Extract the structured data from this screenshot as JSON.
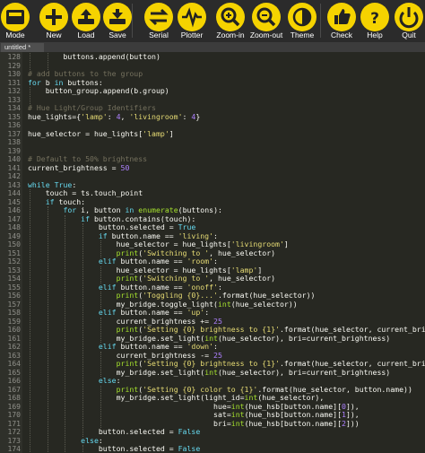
{
  "toolbar": {
    "buttons": [
      {
        "id": "mode",
        "label": "Mode",
        "icon": "mode-icon"
      },
      {
        "id": "new",
        "label": "New",
        "icon": "plus-icon"
      },
      {
        "id": "load",
        "label": "Load",
        "icon": "load-icon"
      },
      {
        "id": "save",
        "label": "Save",
        "icon": "save-icon"
      },
      {
        "id": "serial",
        "label": "Serial",
        "icon": "serial-icon"
      },
      {
        "id": "plotter",
        "label": "Plotter",
        "icon": "plotter-icon"
      },
      {
        "id": "zoom-in",
        "label": "Zoom-in",
        "icon": "zoom-in-icon"
      },
      {
        "id": "zoom-out",
        "label": "Zoom-out",
        "icon": "zoom-out-icon"
      },
      {
        "id": "theme",
        "label": "Theme",
        "icon": "theme-icon"
      },
      {
        "id": "check",
        "label": "Check",
        "icon": "check-icon"
      },
      {
        "id": "help",
        "label": "Help",
        "icon": "help-icon"
      },
      {
        "id": "quit",
        "label": "Quit",
        "icon": "quit-icon"
      }
    ]
  },
  "tab": {
    "title": "untitled *"
  },
  "colors": {
    "accent": "#f5d300",
    "background": "#272822",
    "toolbar": "#2b2b2b",
    "keyword": "#66d9ef",
    "string": "#e6db74",
    "comment": "#75715e",
    "number": "#ae81ff",
    "builtin": "#a6e22e"
  },
  "editor": {
    "lines": [
      {
        "n": "128",
        "indent": 2,
        "tokens": [
          [
            "",
            "buttons.append(button)"
          ]
        ]
      },
      {
        "n": "129",
        "indent": 0,
        "tokens": []
      },
      {
        "n": "130",
        "indent": 0,
        "tokens": [
          [
            "c",
            "# add buttons to the group"
          ]
        ]
      },
      {
        "n": "131",
        "indent": 0,
        "tokens": [
          [
            "k",
            "for"
          ],
          [
            "",
            " b "
          ],
          [
            "k",
            "in"
          ],
          [
            "",
            " buttons:"
          ]
        ]
      },
      {
        "n": "132",
        "indent": 1,
        "tokens": [
          [
            "",
            "button_group.append(b.group)"
          ]
        ]
      },
      {
        "n": "133",
        "indent": 0,
        "tokens": []
      },
      {
        "n": "134",
        "indent": 0,
        "tokens": [
          [
            "c",
            "# Hue Light/Group Identifiers"
          ]
        ]
      },
      {
        "n": "135",
        "indent": 0,
        "tokens": [
          [
            "",
            "hue_lights={"
          ],
          [
            "s",
            "'lamp'"
          ],
          [
            "",
            ": "
          ],
          [
            "n",
            "4"
          ],
          [
            "",
            ", "
          ],
          [
            "s",
            "'livingroom'"
          ],
          [
            "",
            ": "
          ],
          [
            "n",
            "4"
          ],
          [
            "",
            "}"
          ]
        ]
      },
      {
        "n": "136",
        "indent": 0,
        "tokens": []
      },
      {
        "n": "137",
        "indent": 0,
        "tokens": [
          [
            "",
            "hue_selector = hue_lights["
          ],
          [
            "s",
            "'lamp'"
          ],
          [
            "",
            "]"
          ]
        ]
      },
      {
        "n": "138",
        "indent": 0,
        "tokens": []
      },
      {
        "n": "139",
        "indent": 0,
        "tokens": []
      },
      {
        "n": "140",
        "indent": 0,
        "tokens": [
          [
            "c",
            "# Default to 50% brightness"
          ]
        ]
      },
      {
        "n": "141",
        "indent": 0,
        "tokens": [
          [
            "",
            "current_brightness = "
          ],
          [
            "n",
            "50"
          ]
        ]
      },
      {
        "n": "142",
        "indent": 0,
        "tokens": []
      },
      {
        "n": "143",
        "indent": 0,
        "tokens": [
          [
            "k",
            "while"
          ],
          [
            "",
            " "
          ],
          [
            "k",
            "True"
          ],
          [
            "",
            ":"
          ]
        ]
      },
      {
        "n": "144",
        "indent": 1,
        "tokens": [
          [
            "",
            "touch = ts.touch_point"
          ]
        ]
      },
      {
        "n": "145",
        "indent": 1,
        "tokens": [
          [
            "k",
            "if"
          ],
          [
            "",
            " touch:"
          ]
        ]
      },
      {
        "n": "146",
        "indent": 2,
        "tokens": [
          [
            "k",
            "for"
          ],
          [
            "",
            " i, button "
          ],
          [
            "k",
            "in"
          ],
          [
            "",
            " "
          ],
          [
            "b",
            "enumerate"
          ],
          [
            "",
            "(buttons):"
          ]
        ]
      },
      {
        "n": "147",
        "indent": 3,
        "tokens": [
          [
            "k",
            "if"
          ],
          [
            "",
            " button.contains(touch):"
          ]
        ]
      },
      {
        "n": "148",
        "indent": 4,
        "tokens": [
          [
            "",
            "button.selected = "
          ],
          [
            "k",
            "True"
          ]
        ]
      },
      {
        "n": "149",
        "indent": 4,
        "tokens": [
          [
            "k",
            "if"
          ],
          [
            "",
            " button.name == "
          ],
          [
            "s",
            "'living'"
          ],
          [
            "",
            ":"
          ]
        ]
      },
      {
        "n": "150",
        "indent": 5,
        "tokens": [
          [
            "",
            "hue_selector = hue_lights["
          ],
          [
            "s",
            "'livingroom'"
          ],
          [
            "",
            "]"
          ]
        ]
      },
      {
        "n": "151",
        "indent": 5,
        "tokens": [
          [
            "b",
            "print"
          ],
          [
            "",
            "("
          ],
          [
            "s",
            "'Switching to '"
          ],
          [
            "",
            ", hue_selector)"
          ]
        ]
      },
      {
        "n": "152",
        "indent": 4,
        "tokens": [
          [
            "k",
            "elif"
          ],
          [
            "",
            " button.name == "
          ],
          [
            "s",
            "'room'"
          ],
          [
            "",
            ":"
          ]
        ]
      },
      {
        "n": "153",
        "indent": 5,
        "tokens": [
          [
            "",
            "hue_selector = hue_lights["
          ],
          [
            "s",
            "'lamp'"
          ],
          [
            "",
            "]"
          ]
        ]
      },
      {
        "n": "154",
        "indent": 5,
        "tokens": [
          [
            "b",
            "print"
          ],
          [
            "",
            "("
          ],
          [
            "s",
            "'Switching to '"
          ],
          [
            "",
            ", hue_selector)"
          ]
        ]
      },
      {
        "n": "155",
        "indent": 4,
        "tokens": [
          [
            "k",
            "elif"
          ],
          [
            "",
            " button.name == "
          ],
          [
            "s",
            "'onoff'"
          ],
          [
            "",
            ":"
          ]
        ]
      },
      {
        "n": "156",
        "indent": 5,
        "tokens": [
          [
            "b",
            "print"
          ],
          [
            "",
            "("
          ],
          [
            "s",
            "'Toggling {0}...'"
          ],
          [
            "",
            ".format(hue_selector))"
          ]
        ]
      },
      {
        "n": "157",
        "indent": 5,
        "tokens": [
          [
            "",
            "my_bridge.toggle_light("
          ],
          [
            "b",
            "int"
          ],
          [
            "",
            "(hue_selector))"
          ]
        ]
      },
      {
        "n": "158",
        "indent": 4,
        "tokens": [
          [
            "k",
            "elif"
          ],
          [
            "",
            " button.name == "
          ],
          [
            "s",
            "'up'"
          ],
          [
            "",
            ":"
          ]
        ]
      },
      {
        "n": "159",
        "indent": 5,
        "tokens": [
          [
            "",
            "current_brightness += "
          ],
          [
            "n",
            "25"
          ]
        ]
      },
      {
        "n": "160",
        "indent": 5,
        "tokens": [
          [
            "b",
            "print"
          ],
          [
            "",
            "("
          ],
          [
            "s",
            "'Setting {0} brightness to {1}'"
          ],
          [
            "",
            ".format(hue_selector, current_brightness)"
          ]
        ]
      },
      {
        "n": "161",
        "indent": 5,
        "tokens": [
          [
            "",
            "my_bridge.set_light("
          ],
          [
            "b",
            "int"
          ],
          [
            "",
            "(hue_selector), bri=current_brightness)"
          ]
        ]
      },
      {
        "n": "162",
        "indent": 4,
        "tokens": [
          [
            "k",
            "elif"
          ],
          [
            "",
            " button.name == "
          ],
          [
            "s",
            "'down'"
          ],
          [
            "",
            ":"
          ]
        ]
      },
      {
        "n": "163",
        "indent": 5,
        "tokens": [
          [
            "",
            "current_brightness -= "
          ],
          [
            "n",
            "25"
          ]
        ]
      },
      {
        "n": "164",
        "indent": 5,
        "tokens": [
          [
            "b",
            "print"
          ],
          [
            "",
            "("
          ],
          [
            "s",
            "'Setting {0} brightness to {1}'"
          ],
          [
            "",
            ".format(hue_selector, current_brightness)"
          ]
        ]
      },
      {
        "n": "165",
        "indent": 5,
        "tokens": [
          [
            "",
            "my_bridge.set_light("
          ],
          [
            "b",
            "int"
          ],
          [
            "",
            "(hue_selector), bri=current_brightness)"
          ]
        ]
      },
      {
        "n": "166",
        "indent": 4,
        "tokens": [
          [
            "k",
            "else"
          ],
          [
            "",
            ":"
          ]
        ]
      },
      {
        "n": "167",
        "indent": 5,
        "tokens": [
          [
            "b",
            "print"
          ],
          [
            "",
            "("
          ],
          [
            "s",
            "'Setting {0} color to {1}'"
          ],
          [
            "",
            ".format(hue_selector, button.name))"
          ]
        ]
      },
      {
        "n": "168",
        "indent": 5,
        "tokens": [
          [
            "",
            "my_bridge.set_light(light_id="
          ],
          [
            "b",
            "int"
          ],
          [
            "",
            "(hue_selector),"
          ]
        ]
      },
      {
        "n": "169",
        "indent": 5,
        "tokens": [
          [
            "",
            "                      hue="
          ],
          [
            "b",
            "int"
          ],
          [
            "",
            "(hue_hsb[button.name]["
          ],
          [
            "n",
            "0"
          ],
          [
            "",
            "]),"
          ]
        ]
      },
      {
        "n": "170",
        "indent": 5,
        "tokens": [
          [
            "",
            "                      sat="
          ],
          [
            "b",
            "int"
          ],
          [
            "",
            "(hue_hsb[button.name]["
          ],
          [
            "n",
            "1"
          ],
          [
            "",
            "]),"
          ]
        ]
      },
      {
        "n": "171",
        "indent": 5,
        "tokens": [
          [
            "",
            "                      bri="
          ],
          [
            "b",
            "int"
          ],
          [
            "",
            "(hue_hsb[button.name]["
          ],
          [
            "n",
            "2"
          ],
          [
            "",
            "]))"
          ]
        ]
      },
      {
        "n": "172",
        "indent": 4,
        "tokens": [
          [
            "",
            "button.selected = "
          ],
          [
            "k",
            "False"
          ]
        ]
      },
      {
        "n": "173",
        "indent": 3,
        "tokens": [
          [
            "k",
            "else"
          ],
          [
            "",
            ":"
          ]
        ]
      },
      {
        "n": "174",
        "indent": 4,
        "tokens": [
          [
            "",
            "button.selected = "
          ],
          [
            "k",
            "False"
          ]
        ]
      }
    ]
  }
}
